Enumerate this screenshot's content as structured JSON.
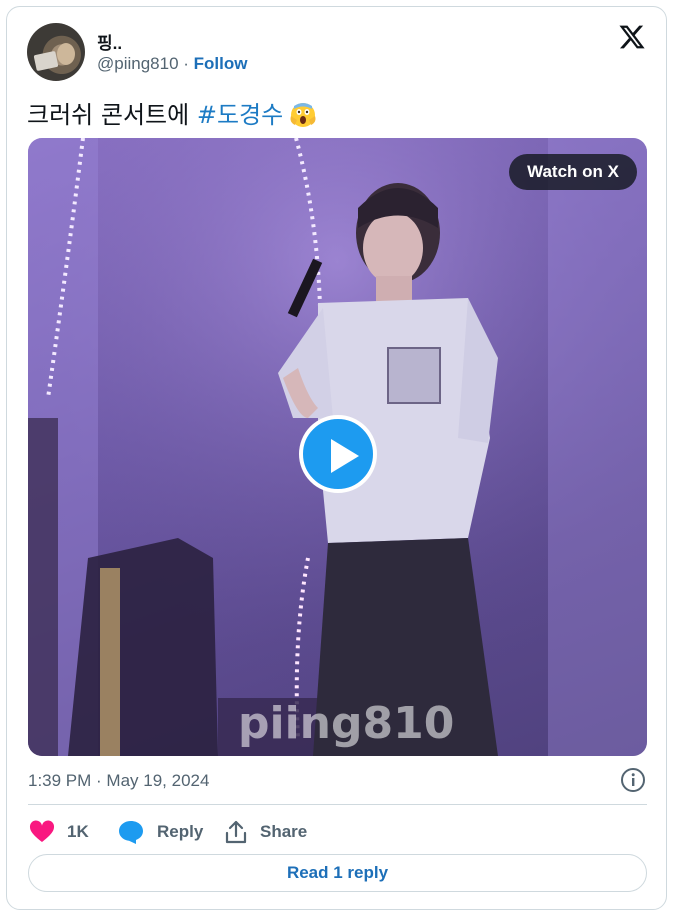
{
  "user": {
    "display_name": "핑..",
    "handle": "@piing810",
    "separator": " · ",
    "follow_label": "Follow"
  },
  "tweet": {
    "text": "크러쉬 콘서트에 ",
    "hashtag": "#도경수",
    "emoji": "screaming-face-emoji"
  },
  "media": {
    "watch_label": "Watch on X",
    "watermark": "piing810"
  },
  "timestamp": "1:39 PM · May 19, 2024",
  "actions": {
    "like_count": "1K",
    "reply_label": "Reply",
    "share_label": "Share"
  },
  "read_reply_label": "Read 1 reply",
  "icons": [
    "x-logo-icon",
    "play-icon",
    "info-icon",
    "heart-icon",
    "reply-bubble-icon",
    "share-icon"
  ],
  "colors": {
    "accent": "#1d9bf0",
    "link": "#1d6fb8",
    "like": "#f91880",
    "muted": "#536471"
  }
}
